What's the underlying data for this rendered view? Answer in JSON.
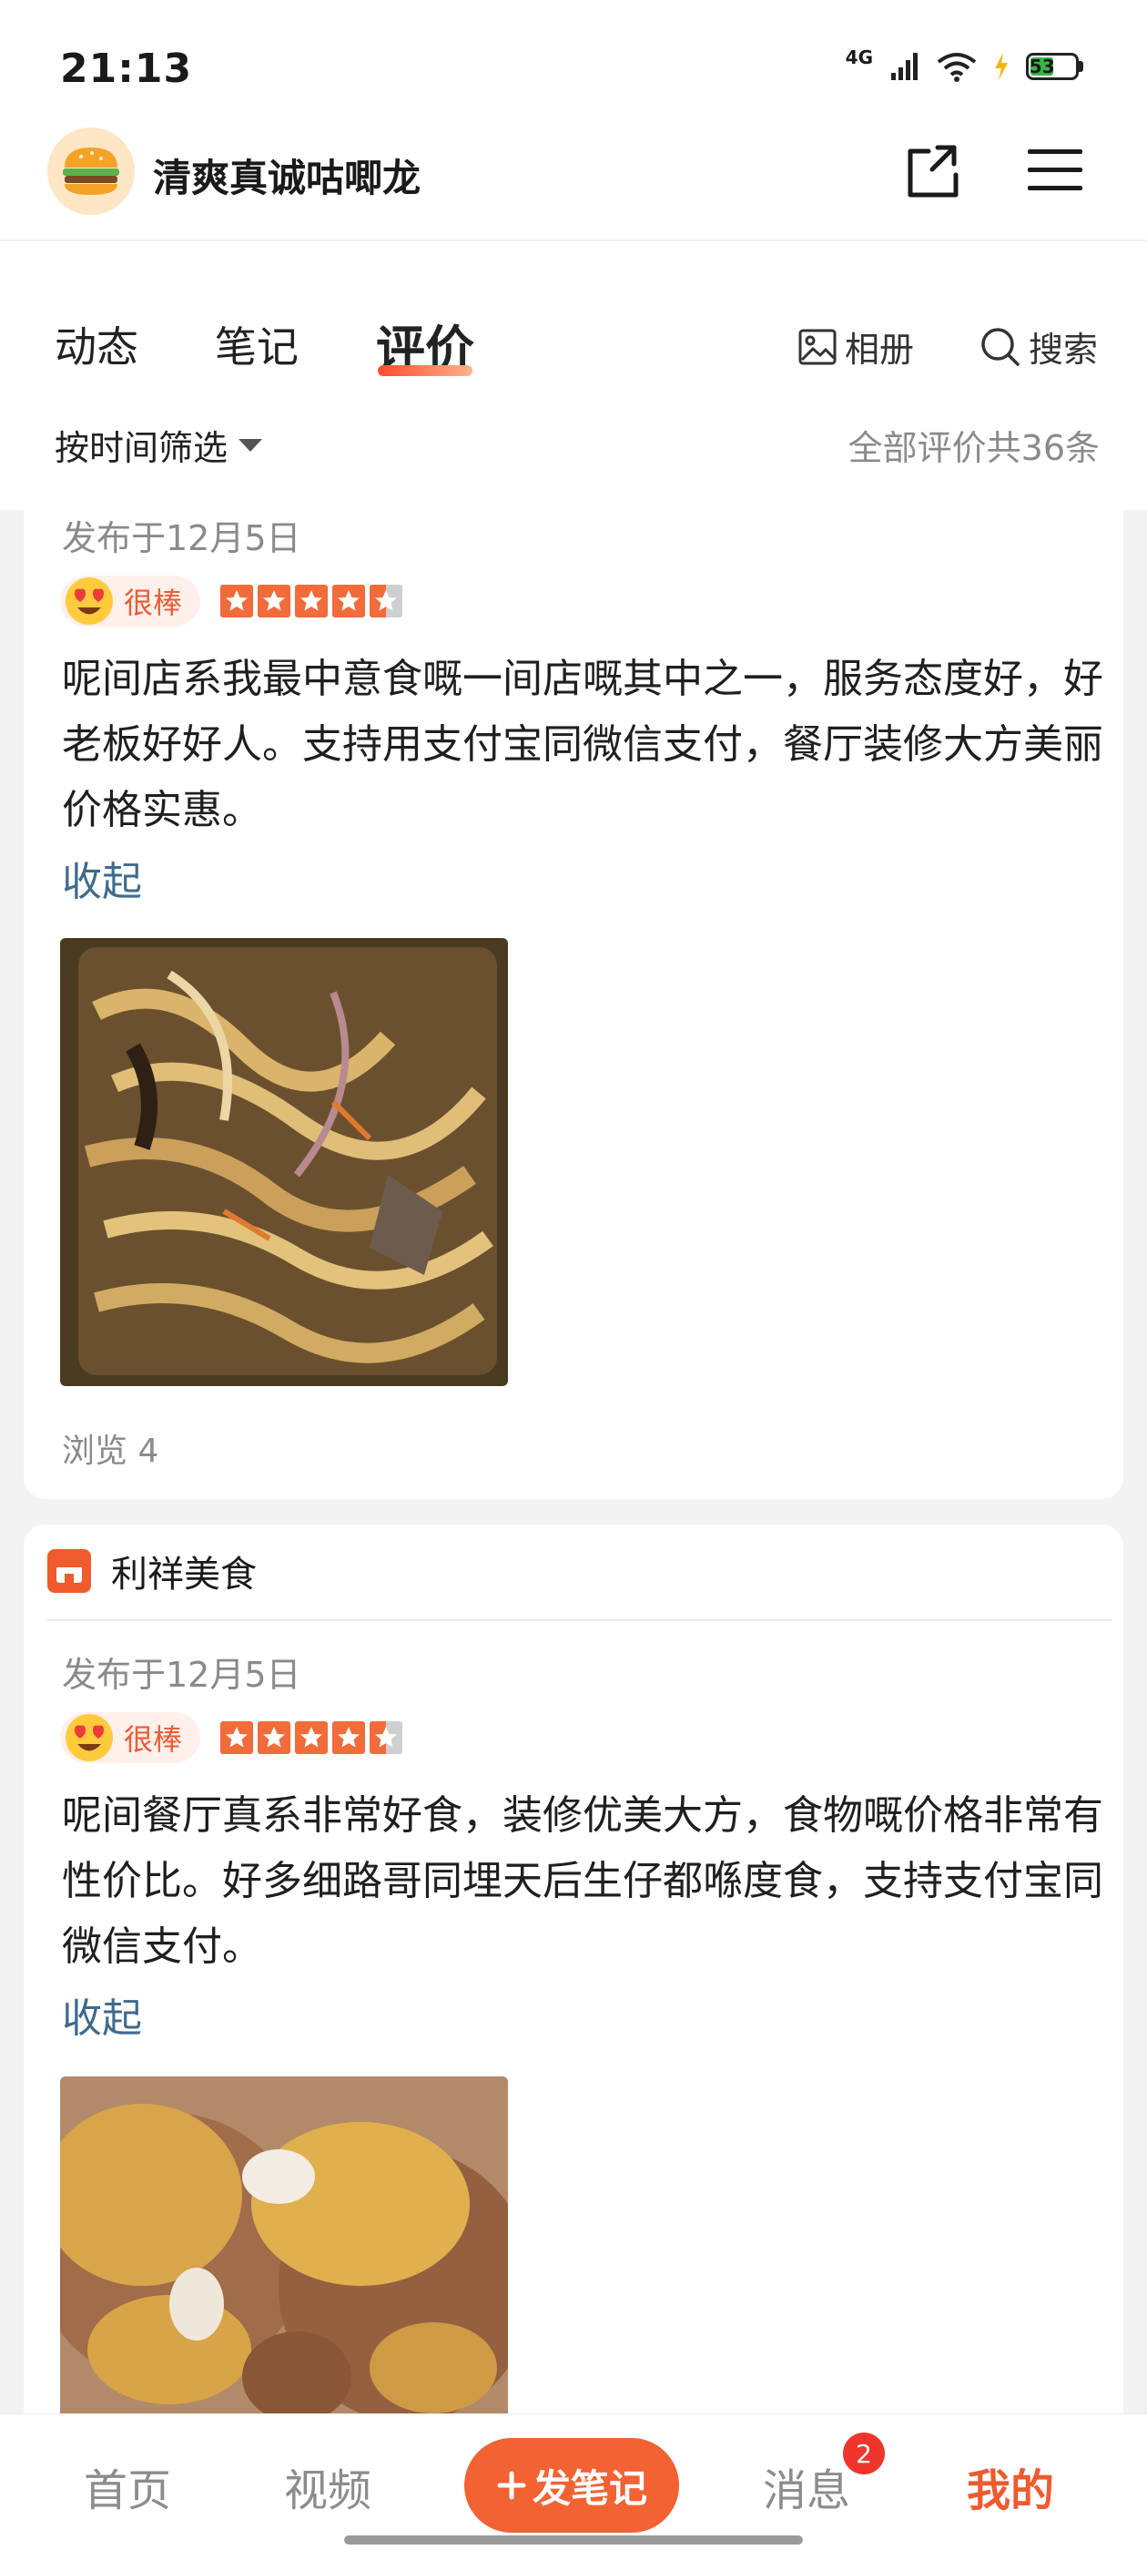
{
  "status_bar": {
    "time": "21:13",
    "network": "4G",
    "battery": "53"
  },
  "header": {
    "title": "清爽真诚咕唧龙"
  },
  "tabs": [
    {
      "label": "动态"
    },
    {
      "label": "笔记"
    },
    {
      "label": "评价"
    }
  ],
  "tools": {
    "album": "相册",
    "search": "搜索"
  },
  "filter": {
    "label": "按时间筛选",
    "total": "全部评价共36条"
  },
  "reviews": [
    {
      "date": "发布于12月5日",
      "badge": "很棒",
      "rating": 4.5,
      "text": "呢间店系我最中意食嘅一间店嘅其中之一，服务态度好，好老板好好人。支持用支付宝同微信支付，餐厅装修大方美丽价格实惠。",
      "collapse": "收起",
      "views": "浏览 4"
    },
    {
      "shop": "利祥美食",
      "date": "发布于12月5日",
      "badge": "很棒",
      "rating": 4.5,
      "text": "呢间餐厅真系非常好食，装修优美大方，食物嘅价格非常有性价比。好多细路哥同埋天后生仔都喺度食，支持支付宝同微信支付。",
      "collapse": "收起"
    }
  ],
  "bottom_nav": {
    "home": "首页",
    "video": "视频",
    "post": "发笔记",
    "messages": "消息",
    "messages_badge": "2",
    "me": "我的"
  },
  "colors": {
    "accent": "#f26233",
    "link": "#3e6a8e"
  }
}
